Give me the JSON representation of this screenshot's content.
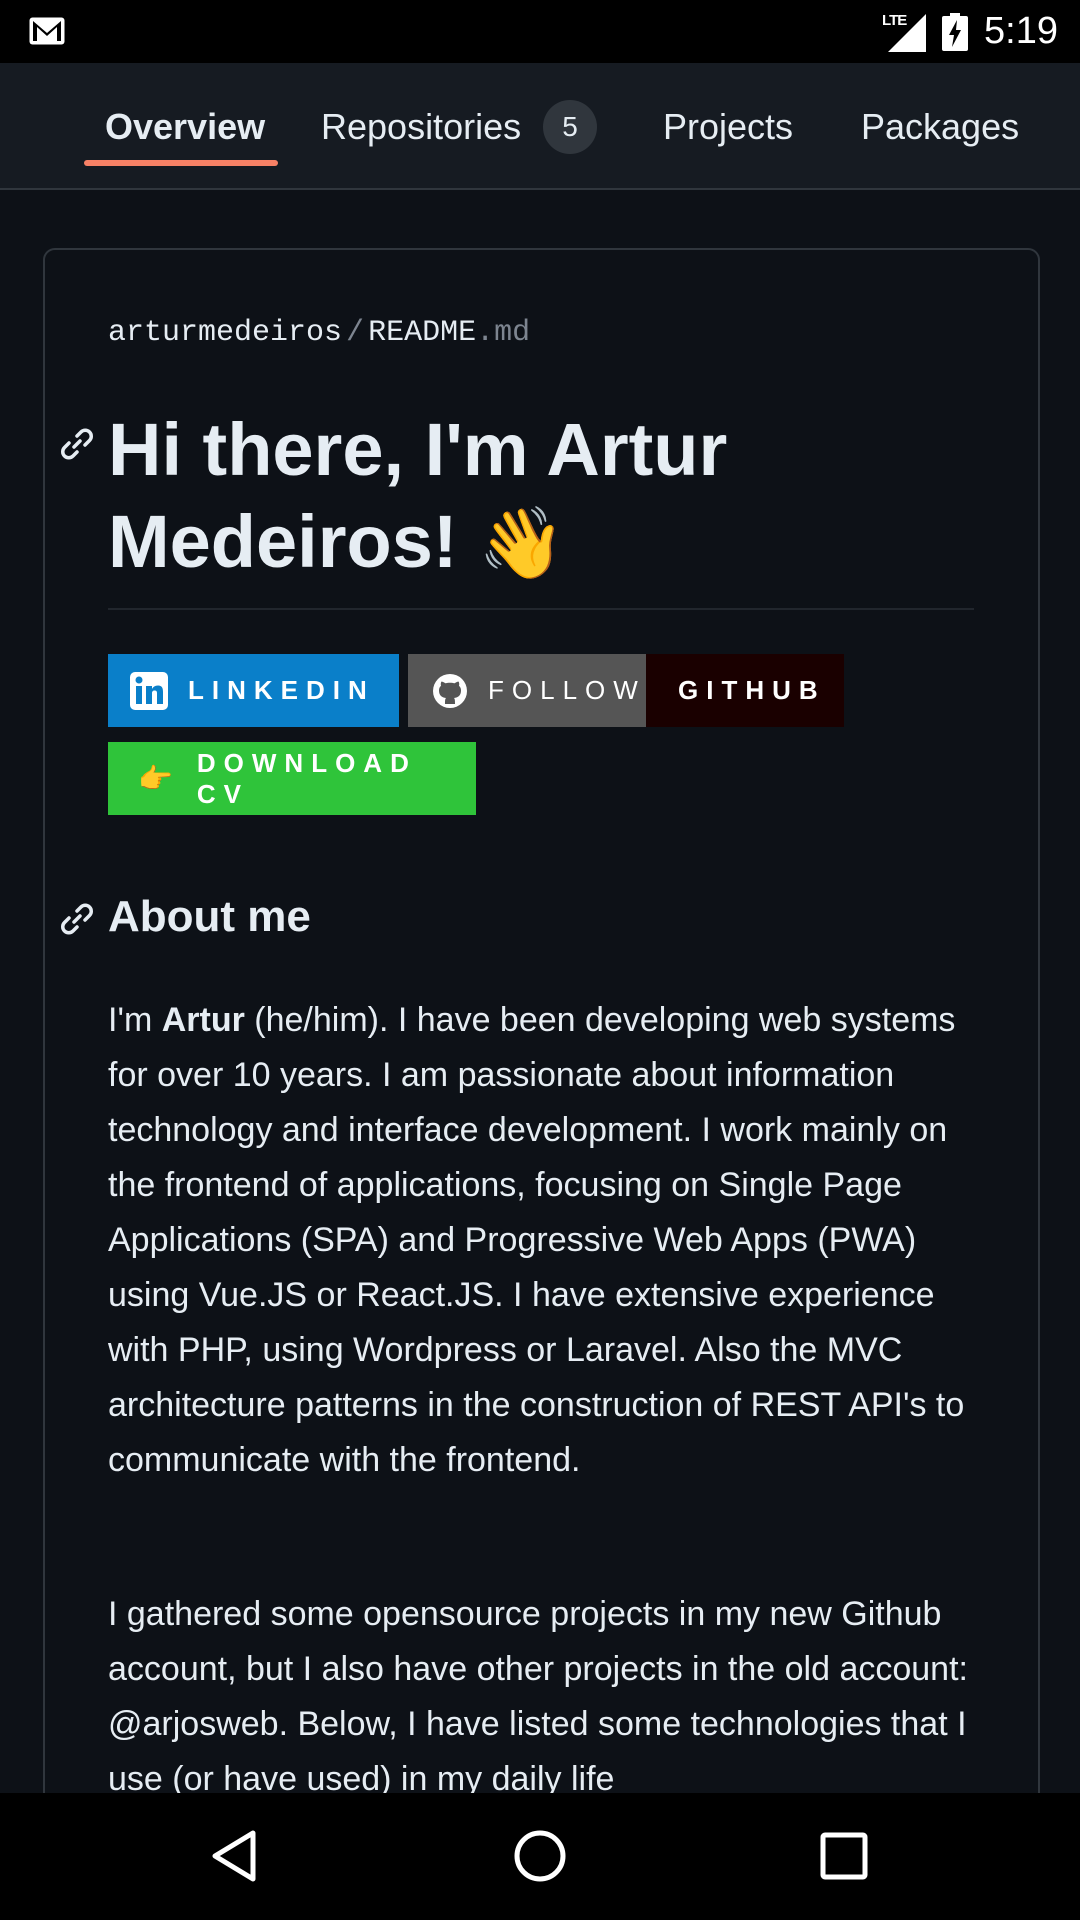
{
  "status_bar": {
    "time": "5:19",
    "network": "LTE"
  },
  "tabs": [
    {
      "label": "Overview",
      "active": true
    },
    {
      "label": "Repositories",
      "count": "5"
    },
    {
      "label": "Projects"
    },
    {
      "label": "Packages"
    }
  ],
  "readme": {
    "owner": "arturmedeiros",
    "separator": "/",
    "file_name": "README",
    "file_ext": ".md",
    "title_line1": "Hi there, I'm Artur",
    "title_line2": "Medeiros!",
    "title_emoji": "👋",
    "badges": {
      "linkedin": "LINKEDIN",
      "follow": "FOLLOW",
      "github": "GITHUB",
      "download_cv": "DOWNLOAD CV",
      "download_emoji": "👉"
    },
    "about_heading": "About me",
    "about_p1": {
      "prefix": "I'm ",
      "name": "Artur",
      "rest": " (he/him). I have been developing web systems for over 10 years. I am passionate about information technology and interface development. I work mainly on the frontend of applications, focusing on Single Page Applications (SPA) and Progressive Web Apps (PWA) using Vue.JS or React.JS. I have extensive experience with PHP, using Wordpress or Laravel. Also the MVC architecture patterns in the construction of REST API's to communicate with the frontend."
    },
    "about_p2": "I gathered some opensource projects in my new Github account, but I also have other projects in the old account: @arjosweb. Below, I have listed some technologies that I use (or have used) in my daily life"
  },
  "colors": {
    "background": "#0d1117",
    "header": "#161b22",
    "border": "#30363d",
    "tab_underline": "#f78166",
    "linkedin_badge": "#0a7fc9",
    "follow_badge": "#555555",
    "github_badge": "#1a0000",
    "download_badge": "#2fc43a"
  }
}
